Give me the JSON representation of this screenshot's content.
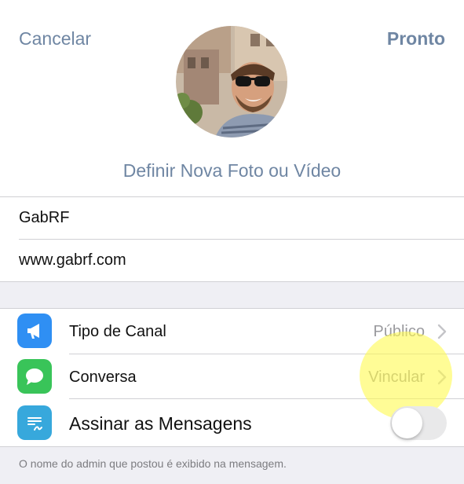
{
  "header": {
    "cancel_label": "Cancelar",
    "done_label": "Pronto"
  },
  "avatar": {
    "icon": "profile-photo"
  },
  "set_photo_label": "Definir Nova Foto ou Vídeo",
  "fields": {
    "name": "GabRF",
    "description": "www.gabrf.com"
  },
  "settings": {
    "items": [
      {
        "label": "Tipo de Canal",
        "value": "Público",
        "icon": "megaphone-icon",
        "icon_color": "#2f8ff3"
      },
      {
        "label": "Conversa",
        "value": "Vincular",
        "icon": "chat-bubble-icon",
        "icon_color": "#39c459"
      },
      {
        "label": "Assinar as Mensagens",
        "icon": "signature-icon",
        "icon_color": "#37a8dc",
        "toggle_on": false
      }
    ],
    "footer_note": "O nome do admin que postou é exibido na mensagem."
  },
  "colors": {
    "accent": "#6f86a3",
    "highlight": "#fff950"
  }
}
